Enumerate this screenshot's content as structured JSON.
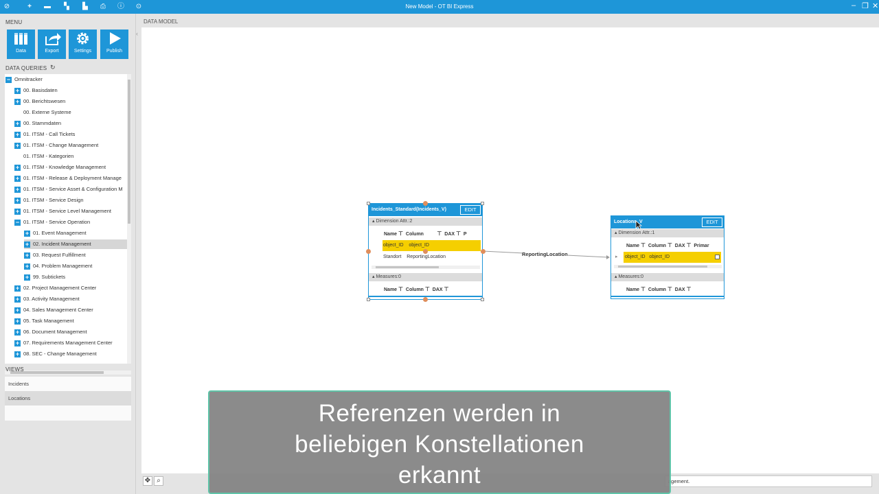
{
  "window": {
    "title": "New Model - OT BI Express",
    "quick_access_icons": [
      "app-icon",
      "plus-icon",
      "save-icon",
      "model-icon",
      "folder-icon",
      "export-icon",
      "info-icon",
      "help-icon"
    ]
  },
  "menu": {
    "header": "MENU",
    "tiles": [
      {
        "label": "Data",
        "icon": "data-columns-icon"
      },
      {
        "label": "Export",
        "icon": "export-arrow-icon"
      },
      {
        "label": "Settings",
        "icon": "gear-icon"
      },
      {
        "label": "Publish",
        "icon": "play-icon"
      }
    ]
  },
  "data_queries": {
    "header": "DATA QUERIES",
    "refresh_icon": "refresh-icon",
    "tree": [
      {
        "label": "Omnitracker",
        "level": 0,
        "expander": "−"
      },
      {
        "label": "00. Basisdaten",
        "level": 1,
        "expander": "+"
      },
      {
        "label": "00. Berichtswesen",
        "level": 1,
        "expander": "+"
      },
      {
        "label": "00. Externe Systeme",
        "level": 1,
        "expander": ""
      },
      {
        "label": "00. Stammdaten",
        "level": 1,
        "expander": "+"
      },
      {
        "label": "01. ITSM - Call Tickets",
        "level": 1,
        "expander": "+"
      },
      {
        "label": "01. ITSM - Change Management",
        "level": 1,
        "expander": "+"
      },
      {
        "label": "01. ITSM - Kategorien",
        "level": 1,
        "expander": ""
      },
      {
        "label": "01. ITSM - Knowledge Management",
        "level": 1,
        "expander": "+"
      },
      {
        "label": "01. ITSM - Release & Deployment Manage",
        "level": 1,
        "expander": "+"
      },
      {
        "label": "01. ITSM - Service Asset & Configuration M",
        "level": 1,
        "expander": "+"
      },
      {
        "label": "01. ITSM - Service Design",
        "level": 1,
        "expander": "+"
      },
      {
        "label": "01. ITSM - Service Level Management",
        "level": 1,
        "expander": "+"
      },
      {
        "label": "01. ITSM - Service Operation",
        "level": 1,
        "expander": "−"
      },
      {
        "label": "01. Event Management",
        "level": 2,
        "expander": "+"
      },
      {
        "label": "02. Incident Management",
        "level": 2,
        "expander": "+",
        "selected": true
      },
      {
        "label": "03. Request Fulfillment",
        "level": 2,
        "expander": "+"
      },
      {
        "label": "04. Problem Management",
        "level": 2,
        "expander": "+"
      },
      {
        "label": "99. Subtickets",
        "level": 2,
        "expander": "+"
      },
      {
        "label": "02. Project Management Center",
        "level": 1,
        "expander": "+"
      },
      {
        "label": "03. Activity Management",
        "level": 1,
        "expander": "+"
      },
      {
        "label": "04. Sales Management Center",
        "level": 1,
        "expander": "+"
      },
      {
        "label": "05. Task Management",
        "level": 1,
        "expander": "+"
      },
      {
        "label": "06. Document Management",
        "level": 1,
        "expander": "+"
      },
      {
        "label": "07. Requirements Management Center",
        "level": 1,
        "expander": "+"
      },
      {
        "label": "08. SEC - Change Management",
        "level": 1,
        "expander": "+"
      }
    ]
  },
  "views": {
    "header": "VIEWS",
    "items": [
      {
        "label": "Incidents",
        "selected": false
      },
      {
        "label": "Locations",
        "selected": true
      }
    ]
  },
  "canvas": {
    "header": "DATA MODEL",
    "status_text": "agement.",
    "tools": [
      "move-icon",
      "zoom-icon"
    ]
  },
  "tables": {
    "incidents": {
      "title": "Incidents_Standard(Incidents_V)",
      "edit_label": "EDIT",
      "dimension_section": "Dimension Attr.:2",
      "measures_section": "Measures:0",
      "dim_columns": [
        "Name",
        "Column",
        "DAX",
        "P"
      ],
      "dim_rows": [
        {
          "name": "object_ID",
          "column": "object_ID",
          "highlighted": true
        },
        {
          "name": "Standort",
          "column": "ReportingLocation",
          "highlighted": false
        }
      ],
      "measure_columns": [
        "Name",
        "Column",
        "DAX"
      ]
    },
    "locations": {
      "title": "Locations_V",
      "edit_label": "EDIT",
      "dimension_section": "Dimension Attr.:1",
      "measures_section": "Measures:0",
      "dim_columns": [
        "Name",
        "Column",
        "DAX",
        "Primar"
      ],
      "dim_rows": [
        {
          "name": "object_ID",
          "column": "object_ID",
          "highlighted": true
        }
      ],
      "measure_columns": [
        "Name",
        "Column",
        "DAX"
      ]
    }
  },
  "relation": {
    "label": "ReportingLocation"
  },
  "caption": {
    "line1": "Referenzen werden in",
    "line2": "beliebigen Konstellationen",
    "line3": "erkannt"
  },
  "colors": {
    "accent": "#1e96d8",
    "highlight": "#f5cf00",
    "handle": "#e08e5c",
    "caption_bg": "#828282",
    "caption_border": "#5fc4a8"
  }
}
